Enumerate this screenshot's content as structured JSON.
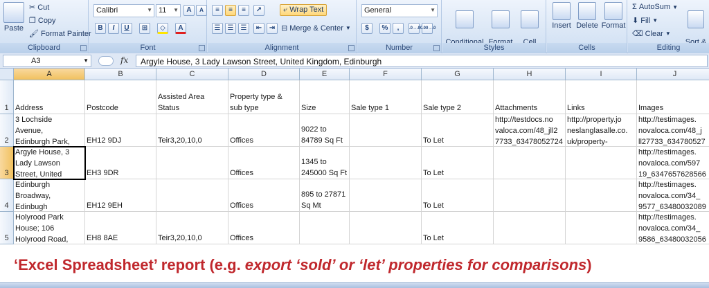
{
  "ribbon": {
    "clipboard": {
      "label": "Clipboard",
      "paste": "Paste",
      "cut": "Cut",
      "copy": "Copy",
      "format_painter": "Format Painter"
    },
    "font": {
      "label": "Font",
      "name": "Calibri",
      "size": "11",
      "bold": "B",
      "italic": "I",
      "underline": "U",
      "grow": "A",
      "shrink": "A",
      "color_a": "A"
    },
    "alignment": {
      "label": "Alignment",
      "wrap_text": "Wrap Text",
      "merge_center": "Merge & Center"
    },
    "number": {
      "label": "Number",
      "format": "General",
      "percent": "%",
      "comma": ",",
      "inc_dec": ".0→.00",
      "dec_dec": ".00→.0"
    },
    "styles": {
      "label": "Styles",
      "conditional": "Conditional\nFormatting",
      "format_table": "Format\nas Table",
      "cell_styles": "Cell\nStyles"
    },
    "cells": {
      "label": "Cells",
      "insert": "Insert",
      "delete": "Delete",
      "format": "Format"
    },
    "editing": {
      "label": "Editing",
      "autosum": "AutoSum",
      "fill": "Fill",
      "clear": "Clear",
      "sort": "Sort &\nFilter"
    }
  },
  "formula_bar": {
    "name_box": "A3",
    "fx": "fx",
    "content": "Argyle House, 3 Lady Lawson Street, United Kingdom, Edinburgh"
  },
  "columns": [
    "A",
    "B",
    "C",
    "D",
    "E",
    "F",
    "G",
    "H",
    "I",
    "J"
  ],
  "rows": [
    "1",
    "2",
    "3",
    "4",
    "5"
  ],
  "cells": {
    "r1": [
      "Address",
      "Postcode",
      "Assisted Area\nStatus",
      "Property type &\nsub type",
      "Size",
      "Sale type 1",
      "Sale type 2",
      "Attachments",
      "Links",
      "Images"
    ],
    "r2": [
      "3 Lochside\nAvenue,\nEdinburgh Park,",
      "EH12 9DJ",
      "Teir3,20,10,0",
      "Offices",
      "9022 to\n84789 Sq Ft",
      "",
      "To Let",
      "http://testdocs.no\nvaloca.com/48_jll2\n7733_63478052724",
      "http://property.jo\nneslanglasalle.co.\nuk/property-",
      "http://testimages.\nnovaloca.com/48_j\nll27733_634780527"
    ],
    "r3": [
      "Argyle House, 3\nLady Lawson\nStreet, United",
      "EH3 9DR",
      "",
      "Offices",
      "1345 to\n245000 Sq Ft",
      "",
      "To Let",
      "",
      "",
      "http://testimages.\nnovaloca.com/597\n19_6347657628566"
    ],
    "r4": [
      "Edinburgh\nBroadway,\nEdinbugh",
      "EH12 9EH",
      "",
      "Offices",
      "895 to 27871\nSq Mt",
      "",
      "To Let",
      "",
      "",
      "http://testimages.\nnovaloca.com/34_\n9577_63480032089"
    ],
    "r5": [
      "Holyrood Park\nHouse; 106\nHolyrood Road,",
      "EH8 8AE",
      "Teir3,20,10,0",
      "Offices",
      "",
      "",
      "To Let",
      "",
      "",
      "http://testimages.\nnovaloca.com/34_\n9586_63480032056"
    ]
  },
  "caption": {
    "prefix": "‘Excel Spreadsheet’ report  (e.g. ",
    "emph": "export ‘sold’ or ‘let’ properties for comparisons",
    "suffix": ")"
  },
  "colors": {
    "selection_header": "#f1c15f",
    "caption_red": "#c0282d"
  }
}
